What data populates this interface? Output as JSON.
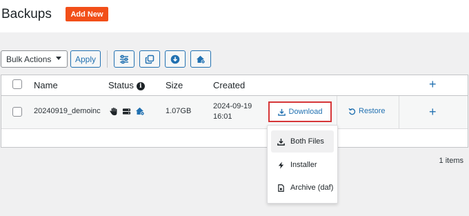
{
  "header": {
    "title": "Backups",
    "add_new_label": "Add New"
  },
  "toolbar": {
    "bulk_actions_label": "Bulk Actions",
    "apply_label": "Apply",
    "icons": [
      "sliders-icon",
      "copy-icon",
      "download-circle-icon",
      "house-gear-icon"
    ]
  },
  "table": {
    "columns": {
      "name": "Name",
      "status": "Status",
      "size": "Size",
      "created": "Created"
    },
    "row": {
      "name": "20240919_demoinc",
      "size": "1.07GB",
      "created_date": "2024-09-19",
      "created_time": "16:01",
      "status_icons": [
        "hand-icon",
        "storage-icon",
        "house-gear-icon"
      ],
      "download_label": "Download",
      "restore_label": "Restore"
    }
  },
  "download_menu": {
    "items": [
      {
        "label": "Both Files",
        "icon": "download-icon"
      },
      {
        "label": "Installer",
        "icon": "bolt-icon"
      },
      {
        "label": "Archive (daf)",
        "icon": "file-archive-icon"
      }
    ]
  },
  "footer": {
    "count_label": "1 items"
  },
  "colors": {
    "accent": "#2271b1",
    "add_new": "#f24f19",
    "highlight_border": "#d63638"
  }
}
